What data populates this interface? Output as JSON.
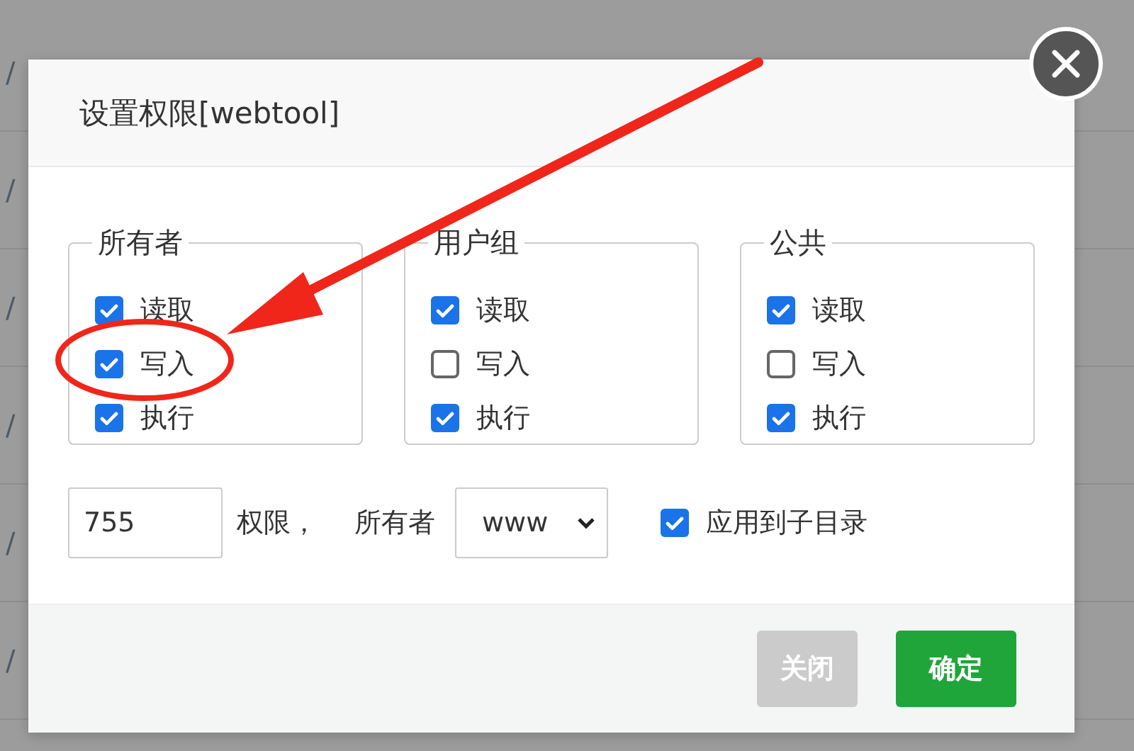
{
  "background_rows": [
    "/",
    "/",
    "/",
    "/",
    "/",
    "/"
  ],
  "dialog": {
    "title": "设置权限[webtool]",
    "groups": [
      {
        "legend": "所有者",
        "options": [
          {
            "label": "读取",
            "checked": true
          },
          {
            "label": "写入",
            "checked": true
          },
          {
            "label": "执行",
            "checked": true
          }
        ]
      },
      {
        "legend": "用户组",
        "options": [
          {
            "label": "读取",
            "checked": true
          },
          {
            "label": "写入",
            "checked": false
          },
          {
            "label": "执行",
            "checked": true
          }
        ]
      },
      {
        "legend": "公共",
        "options": [
          {
            "label": "读取",
            "checked": true
          },
          {
            "label": "写入",
            "checked": false
          },
          {
            "label": "执行",
            "checked": true
          }
        ]
      }
    ],
    "permission_value": "755",
    "permission_label": "权限，",
    "owner_label": "所有者",
    "owner_value": "www",
    "apply_subdirs": {
      "label": "应用到子目录",
      "checked": true
    },
    "buttons": [
      {
        "label": "关闭",
        "kind": "secondary"
      },
      {
        "label": "确定",
        "kind": "primary"
      }
    ]
  }
}
